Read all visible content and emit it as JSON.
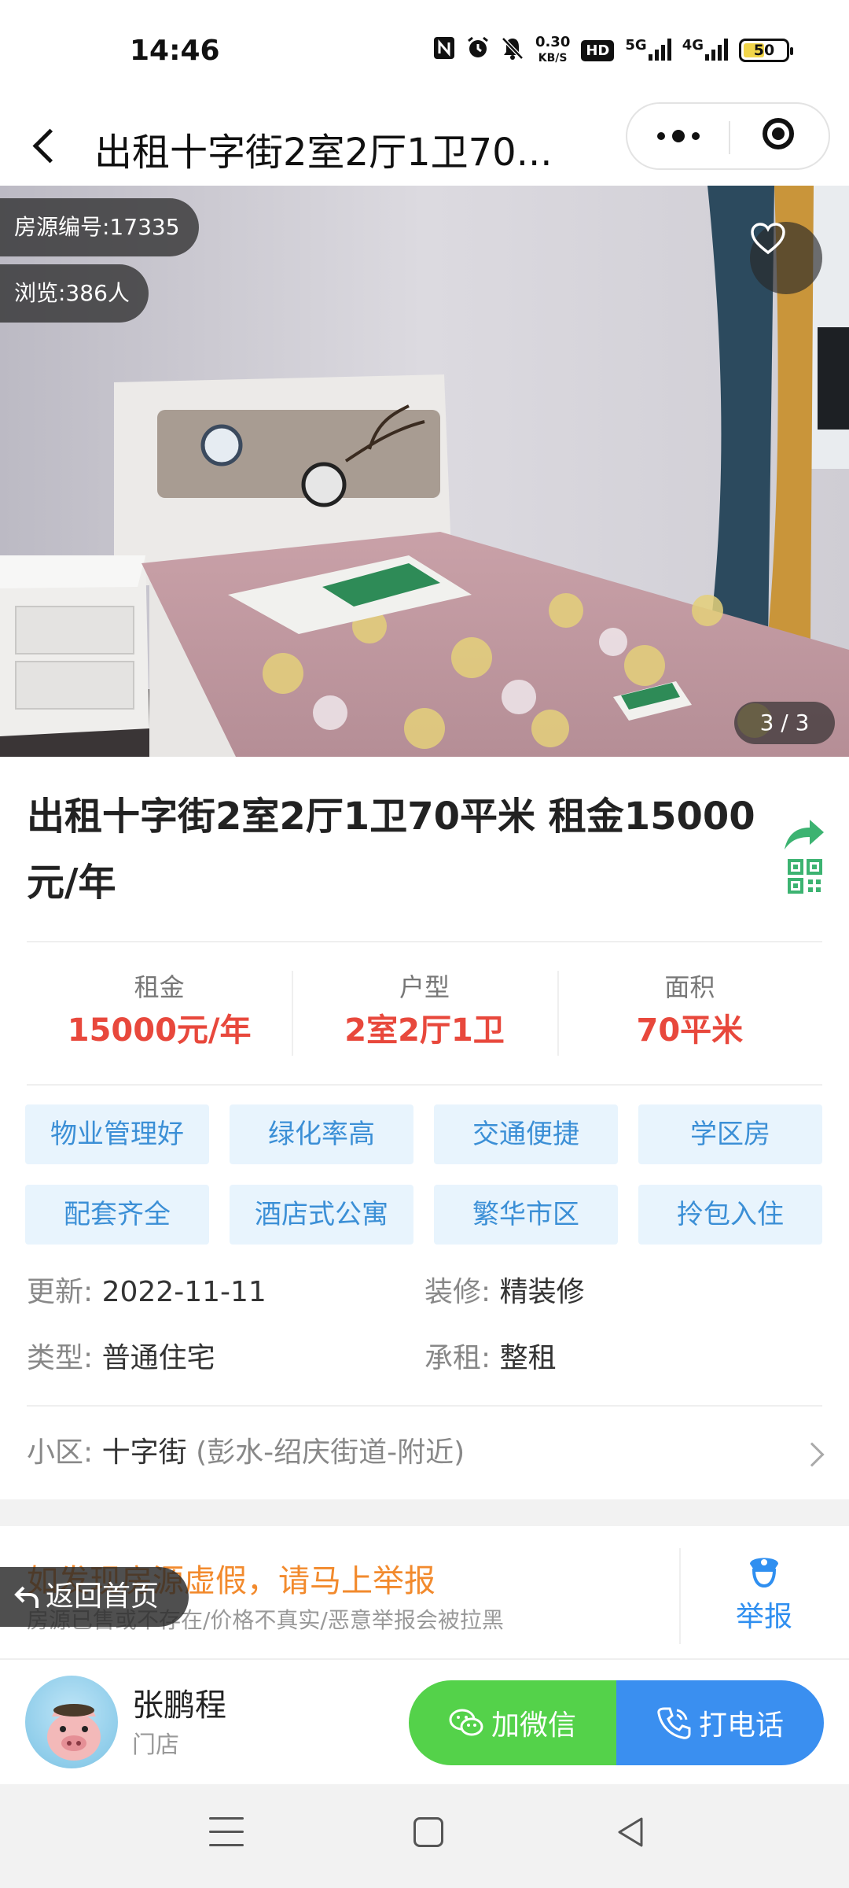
{
  "status_bar": {
    "time": "14:46",
    "net_speed_value": "0.30",
    "net_speed_unit": "KB/S",
    "hd_label": "HD",
    "net_5g": "5G",
    "net_4g": "4G",
    "battery": "50",
    "battery_level": 0.5
  },
  "nav": {
    "title": "出租十字街2室2厅1卫70..."
  },
  "photo": {
    "listing_id_label": "房源编号:17335",
    "views_label": "浏览:386人",
    "counter": "3 / 3"
  },
  "listing": {
    "title": "出租十字街2室2厅1卫70平米 租金15000元/年"
  },
  "stats": [
    {
      "label": "租金",
      "value": "15000元/年"
    },
    {
      "label": "户型",
      "value": "2室2厅1卫"
    },
    {
      "label": "面积",
      "value": "70平米"
    }
  ],
  "tags": [
    "物业管理好",
    "绿化率高",
    "交通便捷",
    "学区房",
    "配套齐全",
    "酒店式公寓",
    "繁华市区",
    "拎包入住"
  ],
  "details": {
    "update_key": "更新:",
    "update_val": "2022-11-11",
    "decor_key": "装修:",
    "decor_val": "精装修",
    "type_key": "类型:",
    "type_val": "普通住宅",
    "lease_key": "承租:",
    "lease_val": "整租",
    "community_key": "小区:",
    "community_val": "十字街",
    "community_extra": "(彭水-绍庆街道-附近)"
  },
  "report": {
    "title": "如发现房源虚假，请马上举报",
    "subtitle": "房源已售或不存在/价格不真实/恶意举报会被拉黑",
    "button": "举报"
  },
  "floating": {
    "home_label": "返回首页"
  },
  "agent": {
    "name": "张鹏程",
    "role": "门店",
    "wechat_label": "加微信",
    "call_label": "打电话"
  },
  "colors": {
    "accent_blue": "#3a8ff0",
    "wechat_green": "#54d24a",
    "price_red": "#e8483c",
    "warning_orange": "#f28a2d",
    "tag_bg": "#e8f4fd",
    "tag_text": "#3b8fd6"
  }
}
